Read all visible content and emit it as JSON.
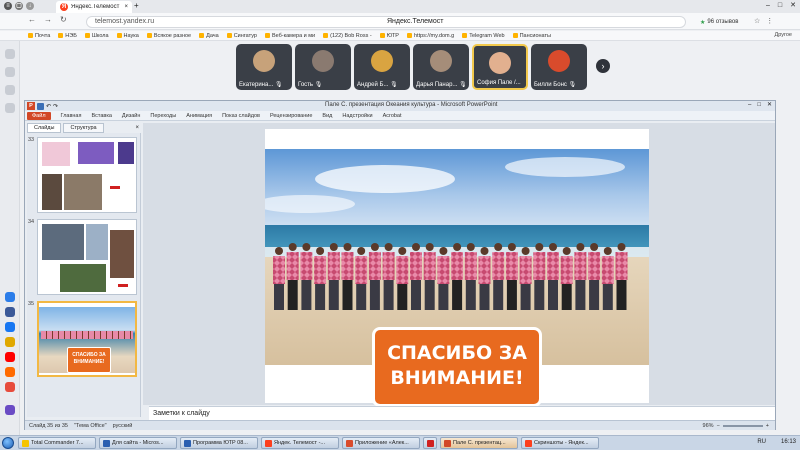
{
  "browser": {
    "tab_title": "Яндекс.Телемост",
    "url": "telemost.yandex.ru",
    "page_title": "Яндекс.Телемост",
    "reviews": "96 отзывов",
    "bookmarks": [
      "Почта",
      "НЭБ",
      "Школа",
      "Наука",
      "Всякое разное",
      "Дача",
      "Сингатур",
      "Веб-камера и ми",
      "(122) Bob Ross -",
      "ЮТР",
      "https://my.dom.g",
      "Telegram Web",
      "Пансионаты"
    ],
    "other_bookmarks": "Другое"
  },
  "participants": [
    {
      "name": "Екатерина..."
    },
    {
      "name": "Гость"
    },
    {
      "name": "Андрей Б..."
    },
    {
      "name": "Дарья Панар..."
    },
    {
      "name": "София Пале /..."
    },
    {
      "name": "Билли Бонс"
    }
  ],
  "ppt": {
    "title": "Пале С. презентация Океания культура - Microsoft PowerPoint",
    "ribbon": [
      "Файл",
      "Главная",
      "Вставка",
      "Дизайн",
      "Переходы",
      "Анимация",
      "Показ слайдов",
      "Рецензирование",
      "Вид",
      "Надстройки",
      "Acrobat"
    ],
    "panel_tabs": [
      "Слайды",
      "Структура"
    ],
    "thumbs": [
      {
        "num": "33"
      },
      {
        "num": "34"
      },
      {
        "num": "35"
      }
    ],
    "thumb35_text": "СПАСИБО ЗА ВНИМАНИЕ!",
    "slide_thanks": "СПАСИБО ЗА ВНИМАНИЕ!",
    "notes_placeholder": "Заметки к слайду",
    "status": [
      "Слайд 35 из 35",
      "\"Тема Office\"",
      "русский"
    ],
    "zoom": "96%"
  },
  "taskbar": {
    "items": [
      "Total Commander 7...",
      "Для сайта - Micros...",
      "Программа ЮТР 08...",
      "Яндек. Телемост -...",
      "Приложение «Алек...",
      "",
      "Пале С. презентац...",
      "Скриншоты - Яндек..."
    ],
    "lang": "RU",
    "time": "16:13"
  },
  "colors": {
    "accent": "#e86a1f",
    "ppt_file": "#d24726",
    "yandex": "#fc3f1d"
  }
}
